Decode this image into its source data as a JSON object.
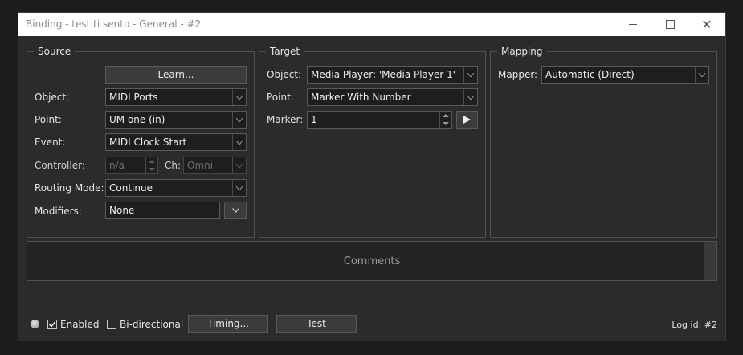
{
  "window": {
    "title": "Binding - test ti sento - General - #2"
  },
  "source": {
    "group_label": "Source",
    "learn_label": "Learn...",
    "object_label": "Object:",
    "object_value": "MIDI Ports",
    "point_label": "Point:",
    "point_value": "UM one (in)",
    "event_label": "Event:",
    "event_value": "MIDI Clock Start",
    "controller_label": "Controller:",
    "controller_value": "n/a",
    "ch_label": "Ch:",
    "ch_value": "Omni",
    "routing_label": "Routing Mode:",
    "routing_value": "Continue",
    "modifiers_label": "Modifiers:",
    "modifiers_value": "None"
  },
  "target": {
    "group_label": "Target",
    "object_label": "Object:",
    "object_value": "Media Player: 'Media Player 1'",
    "point_label": "Point:",
    "point_value": "Marker With Number",
    "marker_label": "Marker:",
    "marker_value": "1"
  },
  "mapping": {
    "group_label": "Mapping",
    "mapper_label": "Mapper:",
    "mapper_value": "Automatic (Direct)"
  },
  "comments": {
    "placeholder": "Comments"
  },
  "footer": {
    "enabled_label": "Enabled",
    "enabled_checked": true,
    "bidirectional_label": "Bi-directional",
    "bidirectional_checked": false,
    "timing_label": "Timing...",
    "test_label": "Test",
    "log_id": "Log id: #2"
  },
  "icons": {
    "dropdown": "chevron-down-icon",
    "play": "play-icon",
    "led": "status-led-icon"
  }
}
